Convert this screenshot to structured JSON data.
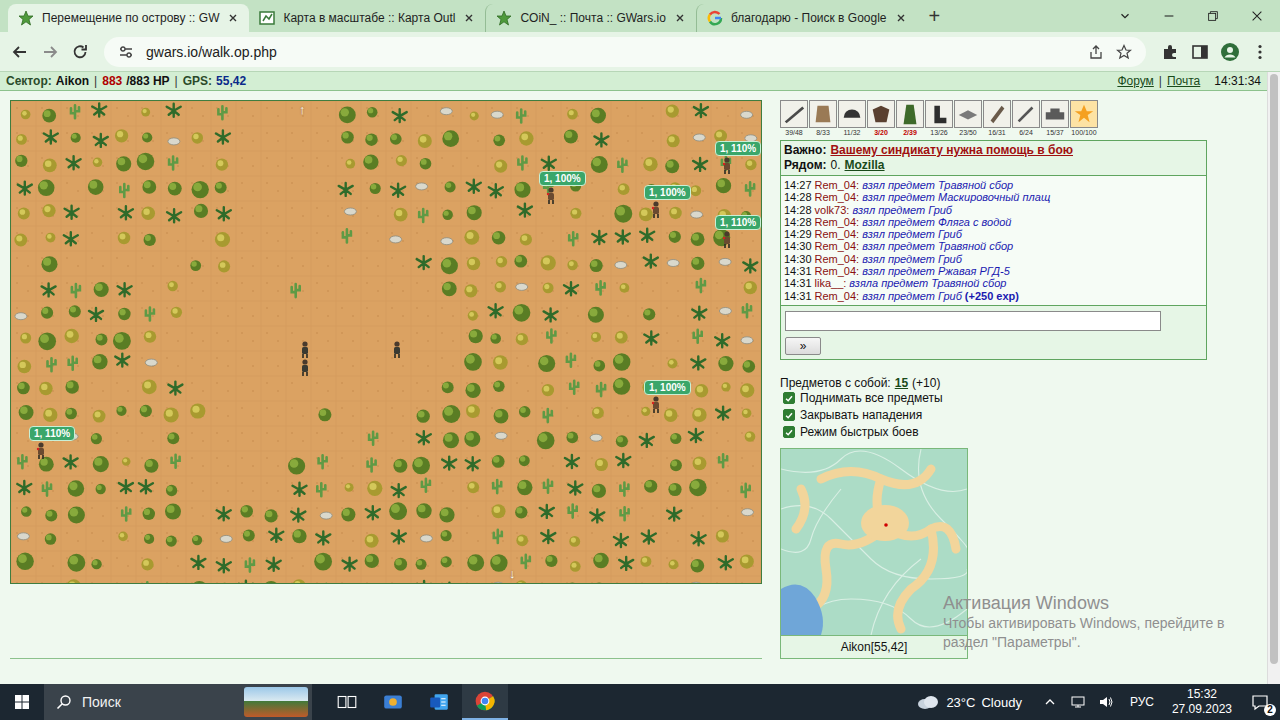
{
  "browser": {
    "tabs": [
      {
        "label": "Перемещение по острову :: GW",
        "selected": true
      },
      {
        "label": "Карта в масштабе :: Карта Outl",
        "selected": false
      },
      {
        "label": "COiN_ :: Почта :: GWars.io",
        "selected": false
      },
      {
        "label": "благодарю - Поиск в Google",
        "selected": false
      }
    ],
    "new_tab": "+",
    "url": "gwars.io/walk.op.php"
  },
  "header": {
    "sector_label": "Сектор:",
    "sector": "Aikon",
    "separator": "|",
    "hp": "883",
    "hp_rest": "/883 HP",
    "gps_label": "GPS:",
    "gps": "55,42",
    "links": [
      "Форум",
      "Почта"
    ],
    "time": "14:31:34"
  },
  "map": {
    "arrow_up": "↑",
    "arrow_down": "↓",
    "players": [
      {
        "label": "1, 110%"
      },
      {
        "label": "1, 100%"
      },
      {
        "label": "1, 100%"
      },
      {
        "label": "1, 110%"
      },
      {
        "label": "1, 100%"
      },
      {
        "label": "1, 110%"
      }
    ]
  },
  "equipment": [
    {
      "count": "39/48",
      "warning": false
    },
    {
      "count": "8/33",
      "warning": false
    },
    {
      "count": "11/32",
      "warning": false
    },
    {
      "count": "3/20",
      "warning": true
    },
    {
      "count": "2/39",
      "warning": true
    },
    {
      "count": "13/26",
      "warning": false
    },
    {
      "count": "23/50",
      "warning": false
    },
    {
      "count": "16/31",
      "warning": false
    },
    {
      "count": "6/24",
      "warning": false
    },
    {
      "count": "15/37",
      "warning": false
    },
    {
      "count": "100/100",
      "warning": false
    }
  ],
  "important": {
    "label": "Важно:",
    "link": "Вашему синдикату нужна помощь в бою"
  },
  "nearby": {
    "label": "Рядом:",
    "count": "0.",
    "name": "Mozilla"
  },
  "log": [
    {
      "time": "14:27",
      "user": "Rem_04:",
      "action": "взял предмет Травяной сбор",
      "bonus": ""
    },
    {
      "time": "14:28",
      "user": "Rem_04:",
      "action": "взял предмет Маскировочный плащ",
      "bonus": ""
    },
    {
      "time": "14:28",
      "user": "volk73:",
      "action": "взял предмет Гриб",
      "bonus": ""
    },
    {
      "time": "14:28",
      "user": "Rem_04:",
      "action": "взял предмет Фляга с водой",
      "bonus": ""
    },
    {
      "time": "14:29",
      "user": "Rem_04:",
      "action": "взял предмет Гриб",
      "bonus": ""
    },
    {
      "time": "14:30",
      "user": "Rem_04:",
      "action": "взял предмет Травяной сбор",
      "bonus": ""
    },
    {
      "time": "14:30",
      "user": "Rem_04:",
      "action": "взял предмет Гриб",
      "bonus": ""
    },
    {
      "time": "14:31",
      "user": "Rem_04:",
      "action": "взял предмет Ржавая РГД-5",
      "bonus": ""
    },
    {
      "time": "14:31",
      "user": "lika__:",
      "action": "взяла предмет Травяной сбор",
      "bonus": ""
    },
    {
      "time": "14:31",
      "user": "Rem_04:",
      "action": "взял предмет Гриб",
      "bonus": "(+250 exp)"
    }
  ],
  "chat": {
    "value": "",
    "send": "»"
  },
  "items": {
    "label": "Предметов с собой:",
    "count": "15",
    "extra": "(+10)"
  },
  "options": [
    {
      "label": "Поднимать все предметы",
      "checked": true
    },
    {
      "label": "Закрывать нападения",
      "checked": true
    },
    {
      "label": "Режим быстрых боев",
      "checked": true
    }
  ],
  "minimap": {
    "caption": "Aikon[55,42]"
  },
  "watermark": {
    "title": "Активация Windows",
    "text": "Чтобы активировать Windows, перейдите в раздел \"Параметры\"."
  },
  "taskbar": {
    "search": "Поиск",
    "weather_temp": "23°C",
    "weather_text": "Cloudy",
    "language": "РУС",
    "time": "15:32",
    "date": "27.09.2023",
    "notifications": "2"
  }
}
